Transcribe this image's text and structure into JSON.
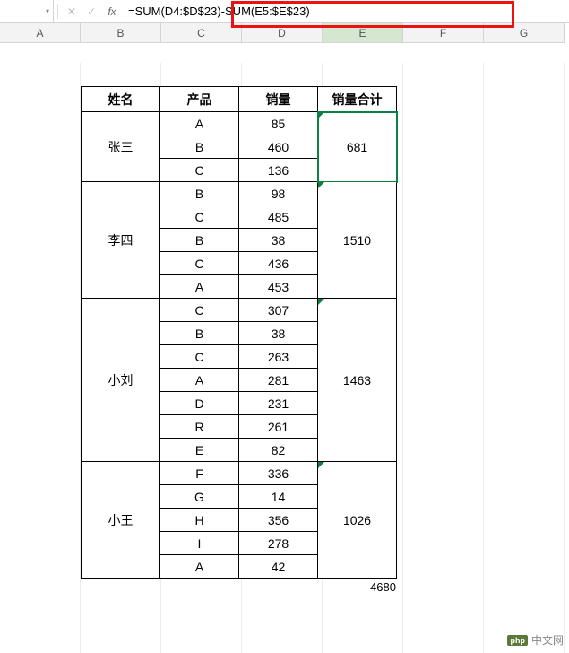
{
  "formula_bar": {
    "name_box": "",
    "dropdown_glyph": "▾",
    "cancel_glyph": "✕",
    "confirm_glyph": "✓",
    "fx_label": "fx",
    "formula": "=SUM(D4:$D$23)-SUM(E5:$E$23)"
  },
  "columns": [
    "A",
    "B",
    "C",
    "D",
    "E",
    "F",
    "G"
  ],
  "active_column": "E",
  "table": {
    "headers": {
      "name": "姓名",
      "product": "产品",
      "sales": "销量",
      "total": "销量合计"
    },
    "groups": [
      {
        "name": "张三",
        "total": "681",
        "rows": [
          {
            "product": "A",
            "sales": "85"
          },
          {
            "product": "B",
            "sales": "460"
          },
          {
            "product": "C",
            "sales": "136"
          }
        ]
      },
      {
        "name": "李四",
        "total": "1510",
        "rows": [
          {
            "product": "B",
            "sales": "98"
          },
          {
            "product": "C",
            "sales": "485"
          },
          {
            "product": "B",
            "sales": "38"
          },
          {
            "product": "C",
            "sales": "436"
          },
          {
            "product": "A",
            "sales": "453"
          }
        ]
      },
      {
        "name": "小刘",
        "total": "1463",
        "rows": [
          {
            "product": "C",
            "sales": "307"
          },
          {
            "product": "B",
            "sales": "38"
          },
          {
            "product": "C",
            "sales": "263"
          },
          {
            "product": "A",
            "sales": "281"
          },
          {
            "product": "D",
            "sales": "231"
          },
          {
            "product": "R",
            "sales": "261"
          },
          {
            "product": "E",
            "sales": "82"
          }
        ]
      },
      {
        "name": "小王",
        "total": "1026",
        "rows": [
          {
            "product": "F",
            "sales": "336"
          },
          {
            "product": "G",
            "sales": "14"
          },
          {
            "product": "H",
            "sales": "356"
          },
          {
            "product": "I",
            "sales": "278"
          },
          {
            "product": "A",
            "sales": "42"
          }
        ]
      }
    ],
    "grand_total": "4680"
  },
  "chart_data": {
    "type": "table",
    "title": "",
    "columns": [
      "姓名",
      "产品",
      "销量",
      "销量合计"
    ],
    "rows": [
      [
        "张三",
        "A",
        85,
        681
      ],
      [
        "张三",
        "B",
        460,
        681
      ],
      [
        "张三",
        "C",
        136,
        681
      ],
      [
        "李四",
        "B",
        98,
        1510
      ],
      [
        "李四",
        "C",
        485,
        1510
      ],
      [
        "李四",
        "B",
        38,
        1510
      ],
      [
        "李四",
        "C",
        436,
        1510
      ],
      [
        "李四",
        "A",
        453,
        1510
      ],
      [
        "小刘",
        "C",
        307,
        1463
      ],
      [
        "小刘",
        "B",
        38,
        1463
      ],
      [
        "小刘",
        "C",
        263,
        1463
      ],
      [
        "小刘",
        "A",
        281,
        1463
      ],
      [
        "小刘",
        "D",
        231,
        1463
      ],
      [
        "小刘",
        "R",
        261,
        1463
      ],
      [
        "小刘",
        "E",
        82,
        1463
      ],
      [
        "小王",
        "F",
        336,
        1026
      ],
      [
        "小王",
        "G",
        14,
        1026
      ],
      [
        "小王",
        "H",
        356,
        1026
      ],
      [
        "小王",
        "I",
        278,
        1026
      ],
      [
        "小王",
        "A",
        42,
        1026
      ]
    ],
    "grand_total": 4680
  },
  "watermark": {
    "logo": "php",
    "text": "中文网"
  }
}
